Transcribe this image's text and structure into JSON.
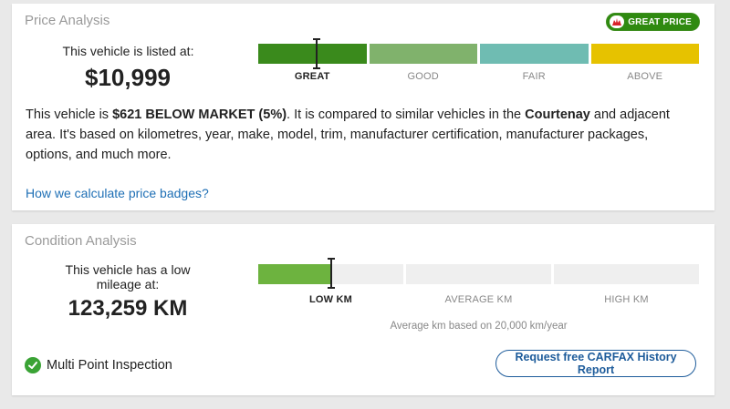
{
  "price_analysis": {
    "title": "Price Analysis",
    "badge_label": "GREAT PRICE",
    "listed_label": "This vehicle is listed at:",
    "price": "$10,999",
    "rating_scale": [
      {
        "label": "GREAT",
        "color": "#3a8a1c",
        "active": true
      },
      {
        "label": "GOOD",
        "color": "#80b26c",
        "active": false
      },
      {
        "label": "FAIR",
        "color": "#6fbcb2",
        "active": false
      },
      {
        "label": "ABOVE",
        "color": "#e6c200",
        "active": false
      }
    ],
    "marker_position_in_segment": 0.54,
    "description": {
      "part1": "This vehicle is ",
      "bold1": "$621 BELOW MARKET (5%)",
      "part2": ". It is compared to similar vehicles in the ",
      "bold2": "Courtenay",
      "part3": " and adjacent area. It's based on kilometres, year, make, model, trim, manufacturer certification, manufacturer packages, options, and much more."
    },
    "how_link": "How we calculate price badges?"
  },
  "condition_analysis": {
    "title": "Condition Analysis",
    "mileage_label": "This vehicle has a low mileage at:",
    "mileage": "123,259 KM",
    "mileage_scale": [
      {
        "label": "LOW KM",
        "active": true
      },
      {
        "label": "AVERAGE KM",
        "active": false
      },
      {
        "label": "HIGH KM",
        "active": false
      }
    ],
    "fill_fraction_of_first_segment": 0.5,
    "fill_color": "#6db33f",
    "empty_color": "#efefef",
    "average_note": "Average km based on 20,000 km/year",
    "inspection_label": "Multi Point Inspection",
    "report_button": "Request free CARFAX History Report"
  },
  "colors": {
    "link": "#1e6fb5",
    "badge_green": "#2f8a10",
    "check_green": "#3aa335",
    "button_blue": "#1e5c9b"
  },
  "icons": {
    "badge": "carfax-maple-leaf-icon",
    "inspection": "check-circle-icon"
  }
}
